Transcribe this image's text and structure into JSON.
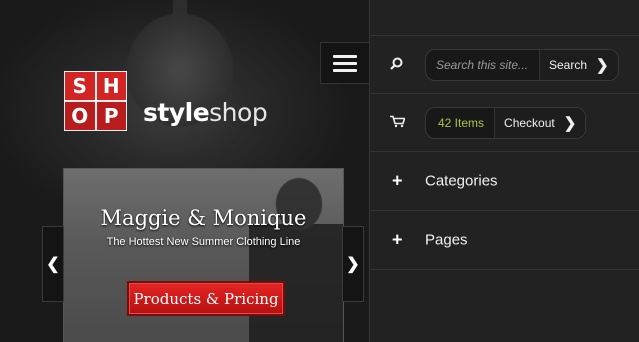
{
  "logo": {
    "letters": [
      "S",
      "H",
      "O",
      "P"
    ],
    "brand_bold": "style",
    "brand_rest": "shop"
  },
  "slider": {
    "title": "Maggie & Monique",
    "subtitle": "The Hottest New Summer Clothing Line",
    "cta_label": "Products & Pricing",
    "prev_icon": "chevron-left-icon",
    "next_icon": "chevron-right-icon"
  },
  "search": {
    "placeholder": "Search this site...",
    "button_label": "Search"
  },
  "cart": {
    "count_label": "42 Items",
    "checkout_label": "Checkout"
  },
  "nav": [
    {
      "label": "Categories"
    },
    {
      "label": "Pages"
    }
  ],
  "colors": {
    "accent_red": "#d32424",
    "count_green": "#a8c24a"
  }
}
